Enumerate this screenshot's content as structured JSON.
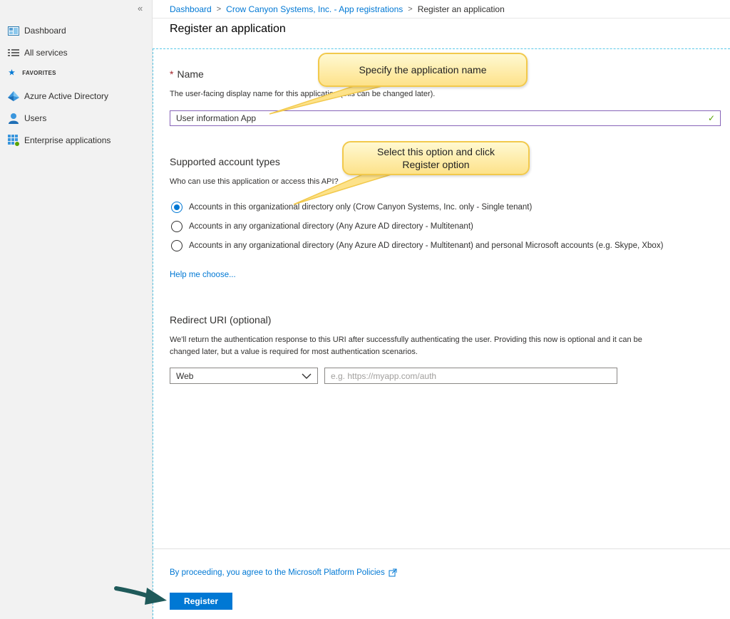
{
  "sidebar": {
    "collapse_glyph": "«",
    "items": [
      {
        "label": "Dashboard",
        "icon": "dashboard-icon"
      },
      {
        "label": "All services",
        "icon": "list-icon"
      }
    ],
    "favorites_label": "FAVORITES",
    "favorites": [
      {
        "label": "Azure Active Directory",
        "icon": "azure-ad-icon"
      },
      {
        "label": "Users",
        "icon": "user-icon"
      },
      {
        "label": "Enterprise applications",
        "icon": "apps-grid-icon"
      }
    ]
  },
  "breadcrumb": {
    "items": [
      "Dashboard",
      "Crow Canyon Systems, Inc. - App registrations"
    ],
    "current": "Register an application"
  },
  "page": {
    "title": "Register an application"
  },
  "name_section": {
    "required_mark": "*",
    "label": "Name",
    "description": "The user-facing display name for this application (this can be changed later).",
    "value": "User information App",
    "valid_glyph": "✓"
  },
  "account_types": {
    "label": "Supported account types",
    "description": "Who can use this application or access this API?",
    "options": [
      {
        "label": "Accounts in this organizational directory only (Crow Canyon Systems, Inc. only - Single tenant)",
        "selected": true
      },
      {
        "label": "Accounts in any organizational directory (Any Azure AD directory - Multitenant)",
        "selected": false
      },
      {
        "label": "Accounts in any organizational directory (Any Azure AD directory - Multitenant) and personal Microsoft accounts (e.g. Skype, Xbox)",
        "selected": false
      }
    ],
    "help_link": "Help me choose..."
  },
  "redirect": {
    "label": "Redirect URI (optional)",
    "description_line1": "We'll return the authentication response to this URI after successfully authenticating the user. Providing this now is optional and it can be",
    "description_line2": "changed later, but a value is required for most authentication scenarios.",
    "platform": "Web",
    "placeholder": "e.g. https://myapp.com/auth"
  },
  "footer": {
    "policy_link": "By proceeding, you agree to the Microsoft Platform Policies",
    "register_label": "Register"
  },
  "callouts": {
    "name": "Specify the application name",
    "register_line1": "Select this option and click",
    "register_line2": "Register option"
  },
  "colors": {
    "accent": "#0078d4",
    "callout_fill": "#fde28a",
    "arrow": "#1f5a5a"
  }
}
